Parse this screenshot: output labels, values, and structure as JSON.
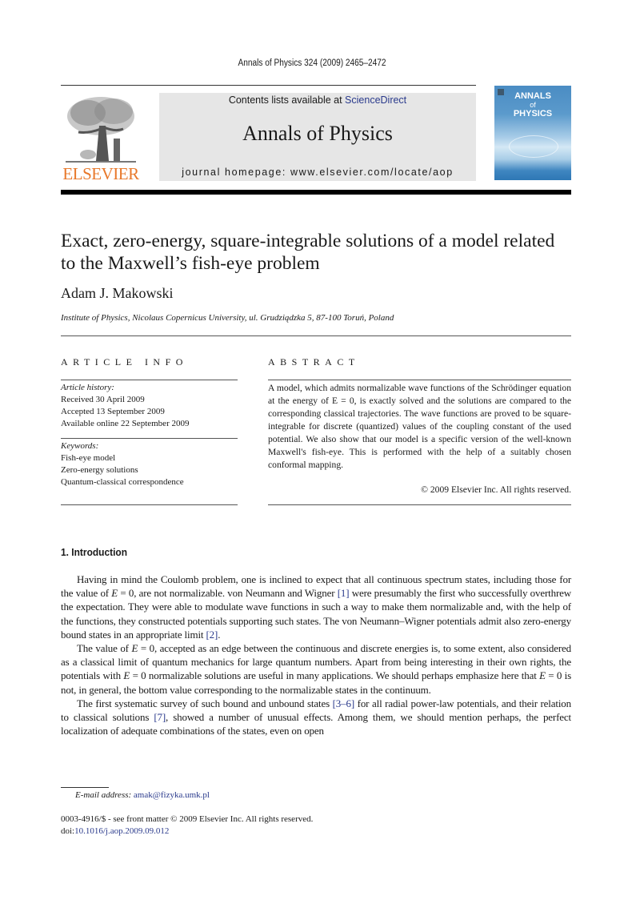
{
  "header": {
    "running_head": "Annals of Physics 324 (2009) 2465–2472",
    "publisher_wordmark": "ELSEVIER",
    "contents_prefix": "Contents lists available at ",
    "contents_link": "ScienceDirect",
    "journal_name": "Annals of Physics",
    "homepage_line": "journal homepage: www.elsevier.com/locate/aop",
    "cover": {
      "title_line1": "ANNALS",
      "title_line2": "of",
      "title_line3": "PHYSICS"
    },
    "colors": {
      "elsevier_orange": "#e8782a",
      "link_blue": "#2a3a8c",
      "masthead_gray": "#e6e6e6",
      "cover_blue": "#4a8cc3"
    }
  },
  "article": {
    "title": "Exact, zero-energy, square-integrable solutions of a model related to the Maxwell’s fish-eye problem",
    "author": "Adam J. Makowski",
    "affiliation": "Institute of Physics, Nicolaus Copernicus University, ul. Grudziądzka 5, 87-100 Toruń, Poland"
  },
  "article_info": {
    "heading": "ARTICLE INFO",
    "history_label": "Article history:",
    "history": [
      "Received 30 April 2009",
      "Accepted 13 September 2009",
      "Available online 22 September 2009"
    ],
    "keywords_label": "Keywords:",
    "keywords": [
      "Fish-eye model",
      "Zero-energy solutions",
      "Quantum-classical correspondence"
    ]
  },
  "abstract": {
    "heading": "ABSTRACT",
    "text": "A model, which admits normalizable wave functions of the Schrödinger equation at the energy of E = 0, is exactly solved and the solutions are compared to the corresponding classical trajectories. The wave functions are proved to be square-integrable for discrete (quantized) values of the coupling constant of the used potential. We also show that our model is a specific version of the well-known Maxwell's fish-eye. This is performed with the help of a suitably chosen conformal mapping.",
    "copyright": "© 2009 Elsevier Inc. All rights reserved."
  },
  "introduction": {
    "heading": "1. Introduction",
    "paragraphs": [
      [
        {
          "t": "Having in mind the Coulomb problem, one is inclined to expect that all continuous spectrum states, including those for the value of "
        },
        {
          "t": "E",
          "i": true
        },
        {
          "t": " = 0, are not normalizable. von Neumann and Wigner "
        },
        {
          "t": "[1]",
          "link": true
        },
        {
          "t": " were presumably the first who successfully overthrew the expectation. They were able to modulate wave functions in such a way to make them normalizable and, with the help of the functions, they constructed potentials supporting such states. The von Neumann–Wigner potentials admit also zero-energy bound states in an appropriate limit "
        },
        {
          "t": "[2]",
          "link": true
        },
        {
          "t": "."
        }
      ],
      [
        {
          "t": "The value of "
        },
        {
          "t": "E",
          "i": true
        },
        {
          "t": " = 0, accepted as an edge between the continuous and discrete energies is, to some extent, also considered as a classical limit of quantum mechanics for large quantum numbers. Apart from being interesting in their own rights, the potentials with "
        },
        {
          "t": "E",
          "i": true
        },
        {
          "t": " = 0 normalizable solutions are useful in many applications. We should perhaps emphasize here that "
        },
        {
          "t": "E",
          "i": true
        },
        {
          "t": " = 0 is not, in general, the bottom value corresponding to the normalizable states in the continuum."
        }
      ],
      [
        {
          "t": "The first systematic survey of such bound and unbound states "
        },
        {
          "t": "[3–6]",
          "link": true
        },
        {
          "t": " for all radial power-law potentials, and their relation to classical solutions "
        },
        {
          "t": "[7]",
          "link": true
        },
        {
          "t": ", showed a number of unusual effects. Among them, we should mention perhaps, the perfect localization of adequate combinations of the states, even on open"
        }
      ]
    ]
  },
  "footnotes": {
    "email_label": "E-mail address: ",
    "email": "amak@fizyka.umk.pl",
    "issn_line": "0003-4916/$ - see front matter © 2009 Elsevier Inc. All rights reserved.",
    "doi_prefix": "doi:",
    "doi": "10.1016/j.aop.2009.09.012"
  }
}
